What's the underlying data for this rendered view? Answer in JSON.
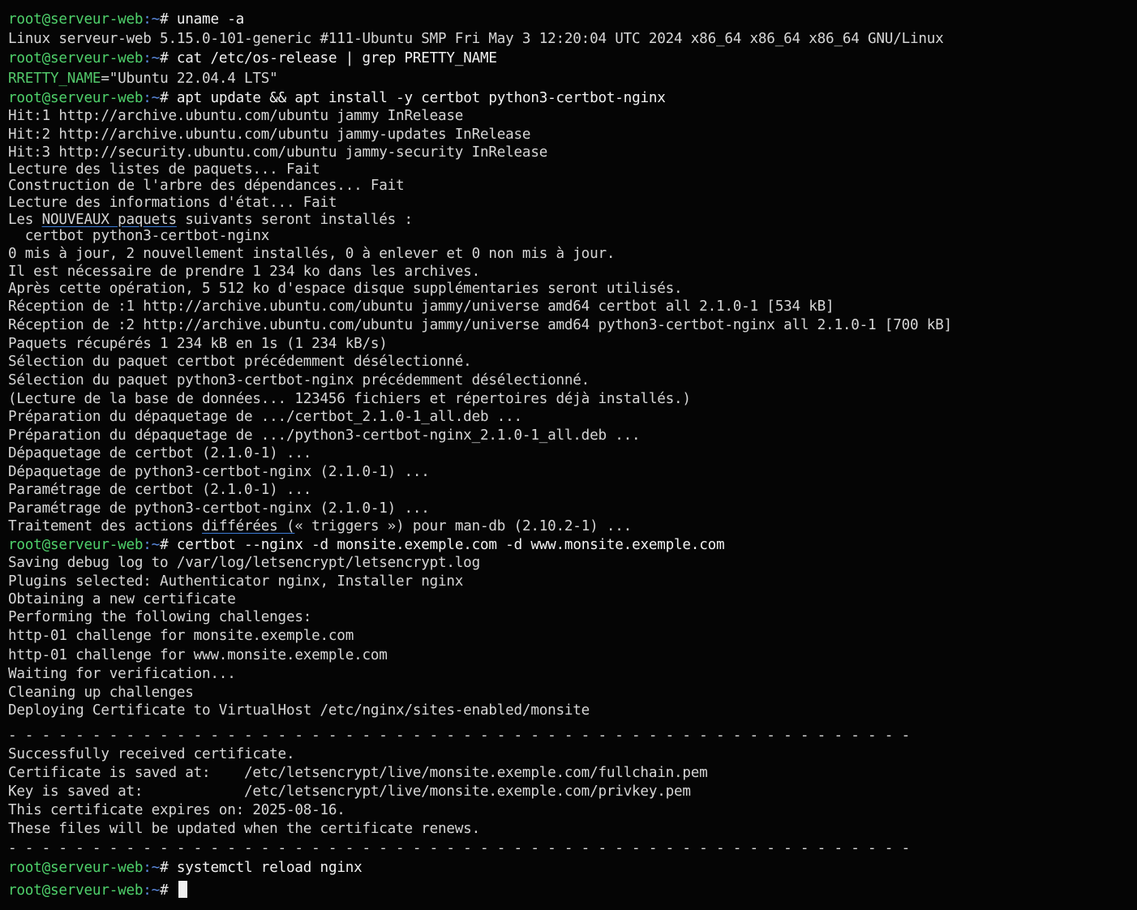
{
  "prompt": {
    "host": "root@serveur-web",
    "path": ":~",
    "symbol": "#"
  },
  "lines": [
    {
      "kind": "prompt",
      "cmd": " uname -a"
    },
    {
      "kind": "out",
      "text": "Linux serveur-web 5.15.0-101-generic #111-Ubuntu SMP Fri May 3 12:20:04 UTC 2024 x86_64 x86_64 x86_64 GNU/Linux"
    },
    {
      "kind": "prompt",
      "cmd": " cat /etc/os-release | grep PRETTY_NAME"
    },
    {
      "kind": "keyval",
      "key": "RRETTY_NAME",
      "text": "=\"Ubuntu 22.04.4 LTS\""
    },
    {
      "kind": "prompt",
      "cmd": " apt update && apt install -y certbot python3-certbot-nginx"
    },
    {
      "kind": "out",
      "text": "Hit:1 http://archive.ubuntu.com/ubuntu jammy InRelease"
    },
    {
      "kind": "out",
      "text": "Hit:2 http://archive.ubuntu.com/ubuntu jammy-updates InRelease"
    },
    {
      "kind": "out",
      "text": "Hit:3 http://security.ubuntu.com/ubuntu jammy-security InRelease"
    },
    {
      "kind": "out",
      "text": "Lecture des listes de paquets... Fait"
    },
    {
      "kind": "out",
      "text": "Construction de l'arbre des dépendances... Fait"
    },
    {
      "kind": "out",
      "text": "Lecture des informations d'état... Fait"
    },
    {
      "kind": "out_u",
      "pre": "Les ",
      "u": "NOUVEAUX paquets",
      "post": " suivants seront installés :"
    },
    {
      "kind": "out",
      "text": "  certbot python3-certbot-nginx"
    },
    {
      "kind": "out",
      "text": "0 mis à jour, 2 nouvellement installés, 0 à enlever et 0 non mis à jour."
    },
    {
      "kind": "out",
      "text": "Il est nécessaire de prendre 1 234 ko dans les archives."
    },
    {
      "kind": "out",
      "text": "Après cette opération, 5 512 ko d'espace disque supplémentaries seront utilisés."
    },
    {
      "kind": "out",
      "text": "Réception de :1 http://archive.ubuntu.com/ubuntu jammy/universe amd64 certbot all 2.1.0-1 [534 kB]"
    },
    {
      "kind": "out",
      "text": "Réception de :2 http://archive.ubuntu.com/ubuntu jammy/universe amd64 python3-certbot-nginx all 2.1.0-1 [700 kB]"
    },
    {
      "kind": "out",
      "text": "Paquets récupérés 1 234 kB en 1s (1 234 kB/s)"
    },
    {
      "kind": "out",
      "text": "Sélection du paquet certbot précédemment désélectionné."
    },
    {
      "kind": "out",
      "text": "Sélection du paquet python3-certbot-nginx précédemment désélectionné."
    },
    {
      "kind": "out",
      "text": "(Lecture de la base de données... 123456 fichiers et répertoires déjà installés.)"
    },
    {
      "kind": "out",
      "text": "Préparation du dépaquetage de .../certbot_2.1.0-1_all.deb ..."
    },
    {
      "kind": "out",
      "text": "Préparation du dépaquetage de .../python3-certbot-nginx_2.1.0-1_all.deb ..."
    },
    {
      "kind": "out",
      "text": "Dépaquetage de certbot (2.1.0-1) ..."
    },
    {
      "kind": "out",
      "text": "Dépaquetage de python3-certbot-nginx (2.1.0-1) ..."
    },
    {
      "kind": "out",
      "text": "Paramétrage de certbot (2.1.0-1) ..."
    },
    {
      "kind": "out",
      "text": "Paramétrage de python3-certbot-nginx (2.1.0-1) ..."
    },
    {
      "kind": "out_u",
      "pre": "Traitement des actions ",
      "u": "différées (",
      "post": "« triggers ») pour man-db (2.10.2-1) ..."
    },
    {
      "kind": "prompt",
      "cmd": " certbot --nginx -d monsite.exemple.com -d www.monsite.exemple.com"
    },
    {
      "kind": "out",
      "text": "Saving debug log to /var/log/letsencrypt/letsencrypt.log"
    },
    {
      "kind": "out",
      "text": "Plugins selected: Authenticator nginx, Installer nginx"
    },
    {
      "kind": "out",
      "text": "Obtaining a new certificate"
    },
    {
      "kind": "out",
      "text": "Performing the following challenges:"
    },
    {
      "kind": "out",
      "text": "http-01 challenge for monsite.exemple.com"
    },
    {
      "kind": "out",
      "text": "http-01 challenge for www.monsite.exemple.com"
    },
    {
      "kind": "out",
      "text": "Waiting for verification..."
    },
    {
      "kind": "out",
      "text": "Cleaning up challenges"
    },
    {
      "kind": "out",
      "text": "Deploying Certificate to VirtualHost /etc/nginx/sites-enabled/monsite"
    },
    {
      "kind": "blank",
      "text": ""
    },
    {
      "kind": "dashes",
      "text": "- - - - - - - - - - - - - - - - - - - - - - - - - - - - - - - - - - - - - - - - - - - - - - - - - - - - - -"
    },
    {
      "kind": "out",
      "text": "Successfully received certificate."
    },
    {
      "kind": "out",
      "text": "Certificate is saved at:    /etc/letsencrypt/live/monsite.exemple.com/fullchain.pem"
    },
    {
      "kind": "out",
      "text": "Key is saved at:            /etc/letsencrypt/live/monsite.exemple.com/privkey.pem"
    },
    {
      "kind": "out",
      "text": "This certificate expires on: 2025-08-16."
    },
    {
      "kind": "out",
      "text": "These files will be updated when the certificate renews."
    },
    {
      "kind": "blank",
      "text": ""
    },
    {
      "kind": "dashes",
      "text": "- - - - - - - - - - - - - - - - - - - - - - - - - - - - - - - - - - - - - - - - - - - - - - - - - - - - - -"
    },
    {
      "kind": "prompt",
      "cmd": " systemctl reload nginx"
    },
    {
      "kind": "prompt_cursor",
      "cmd": " "
    }
  ]
}
